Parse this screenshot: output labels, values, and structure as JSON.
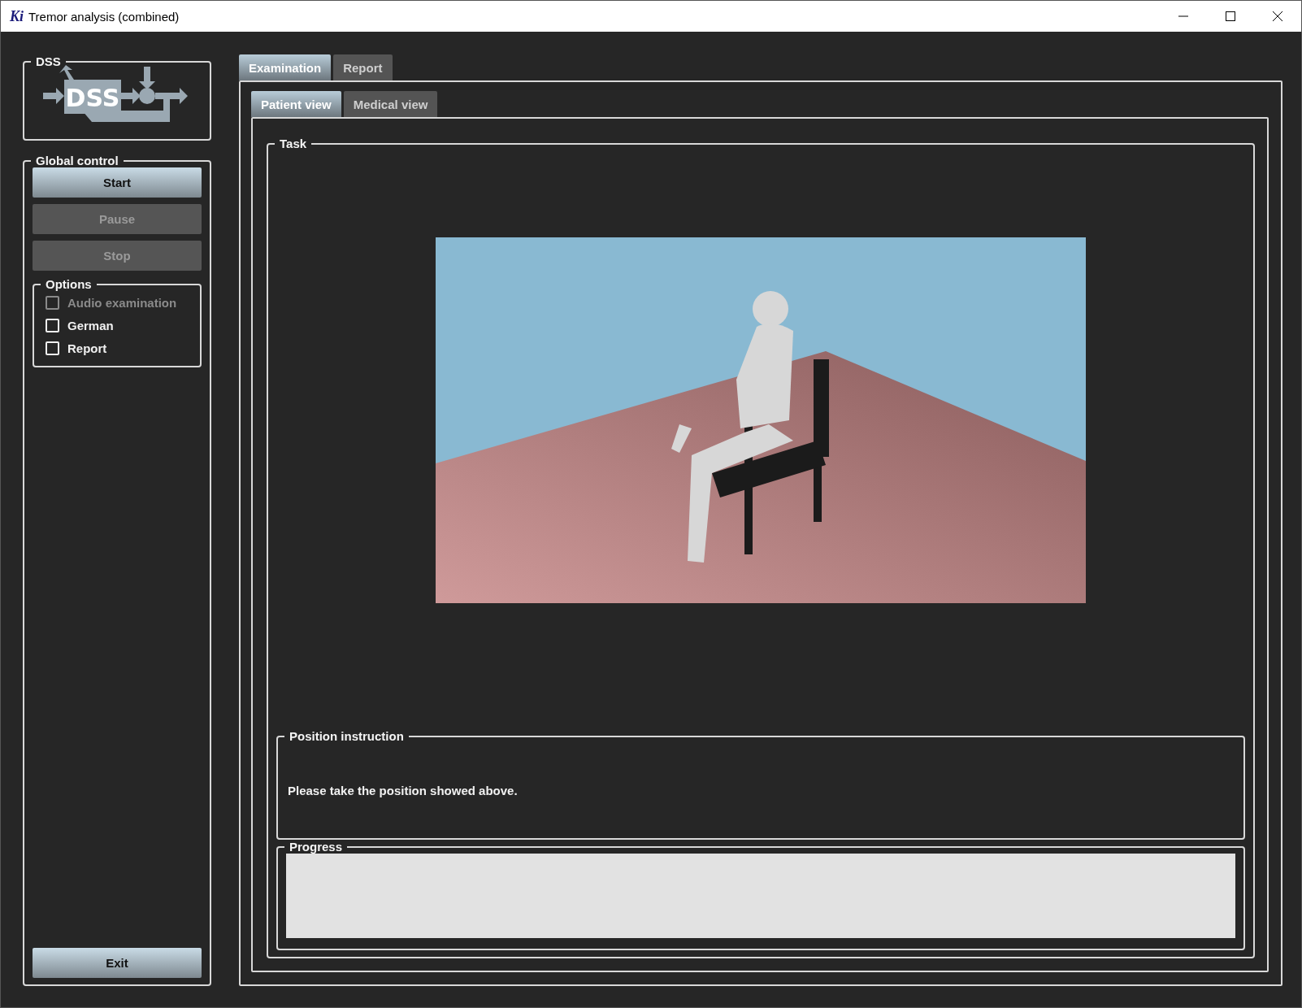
{
  "window": {
    "title": "Tremor analysis (combined)",
    "icon_text": "Ki"
  },
  "logo_group": {
    "title": "DSS",
    "logo_text": "DSS"
  },
  "global_control": {
    "title": "Global control",
    "buttons": [
      {
        "label": "Start",
        "disabled": false
      },
      {
        "label": "Pause",
        "disabled": true
      },
      {
        "label": "Stop",
        "disabled": true
      }
    ],
    "options": {
      "title": "Options",
      "items": [
        {
          "label": "Audio examination",
          "checked": false,
          "disabled": true
        },
        {
          "label": "German",
          "checked": false,
          "disabled": false
        },
        {
          "label": "Report",
          "checked": false,
          "disabled": false
        }
      ]
    },
    "exit_button": "Exit"
  },
  "tabs": [
    {
      "label": "Examination",
      "selected": true
    },
    {
      "label": "Report",
      "selected": false
    }
  ],
  "subtabs": [
    {
      "label": "Patient view",
      "selected": true
    },
    {
      "label": "Medical view",
      "selected": false
    }
  ],
  "task": {
    "title": "Task"
  },
  "position_instruction": {
    "title": "Position instruction",
    "text": "Please take the position showed above."
  },
  "progress": {
    "title": "Progress",
    "level": 0
  }
}
